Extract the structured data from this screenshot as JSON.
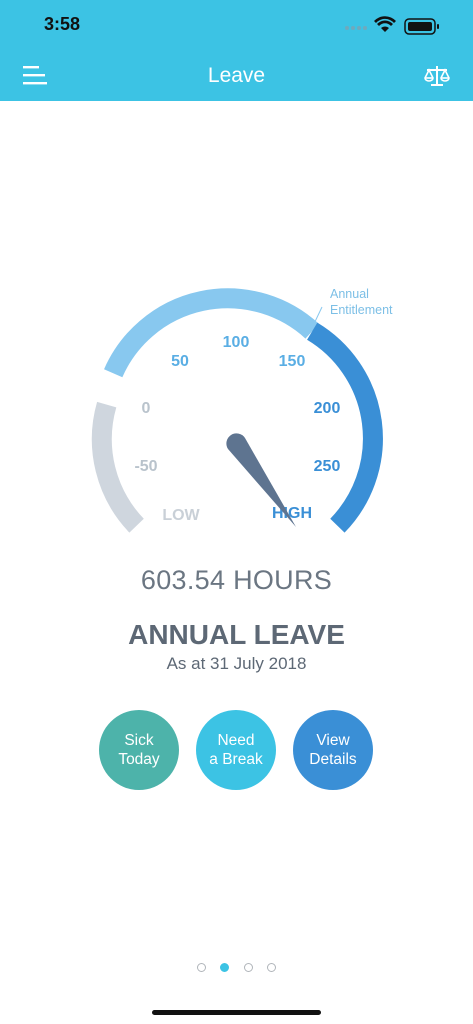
{
  "status_bar": {
    "time": "3:58"
  },
  "nav": {
    "title": "Leave",
    "menu_icon": "menu-icon",
    "right_icon": "scales-icon"
  },
  "gauge": {
    "scale_labels": [
      "-50",
      "0",
      "50",
      "100",
      "150",
      "200",
      "250"
    ],
    "low_label": "LOW",
    "high_label": "HIGH",
    "entitlement_label_line1": "Annual",
    "entitlement_label_line2": "Entitlement",
    "colors": {
      "negative": "#cfd6de",
      "normal": "#88c8ef",
      "high": "#3a8fd6",
      "needle": "#5e7490"
    }
  },
  "summary": {
    "hours": "603.54 HOURS",
    "leave_type": "ANNUAL LEAVE",
    "as_at": "As at 31 July 2018"
  },
  "actions": [
    {
      "label": "Sick\nToday",
      "color": "#4db3aa"
    },
    {
      "label": "Need\na Break",
      "color": "#3cc3e4"
    },
    {
      "label": "View\nDetails",
      "color": "#3a8fd6"
    }
  ],
  "pager": {
    "pages": 4,
    "active_index": 1
  }
}
